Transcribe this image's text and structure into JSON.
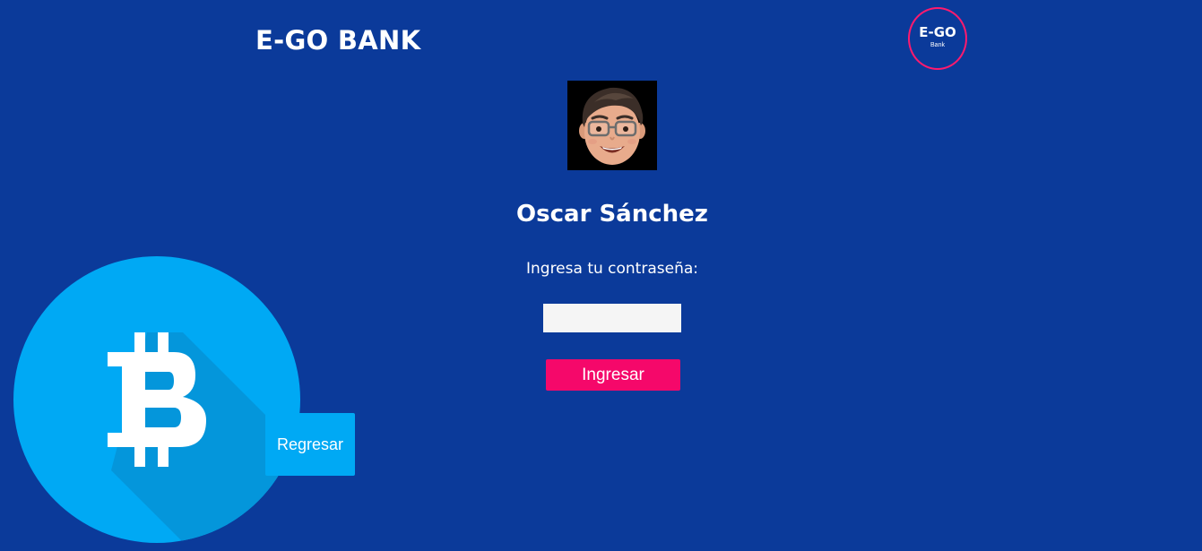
{
  "header": {
    "brand_title": "E-GO BANK",
    "logo_text": "E-GO",
    "logo_subtext": "Bank"
  },
  "login": {
    "user_name": "Oscar Sánchez",
    "password_label": "Ingresa tu contraseña:",
    "password_value": "",
    "submit_label": "Ingresar",
    "back_label": "Regresar"
  },
  "colors": {
    "background": "#0b3a9a",
    "accent": "#f5086a",
    "secondary_button": "#00a9f4",
    "bitcoin_circle": "#00a9f4",
    "logo_ring": "#ff1a6e"
  },
  "icons": {
    "avatar": "memoji-avatar",
    "decoration": "bitcoin-icon"
  }
}
